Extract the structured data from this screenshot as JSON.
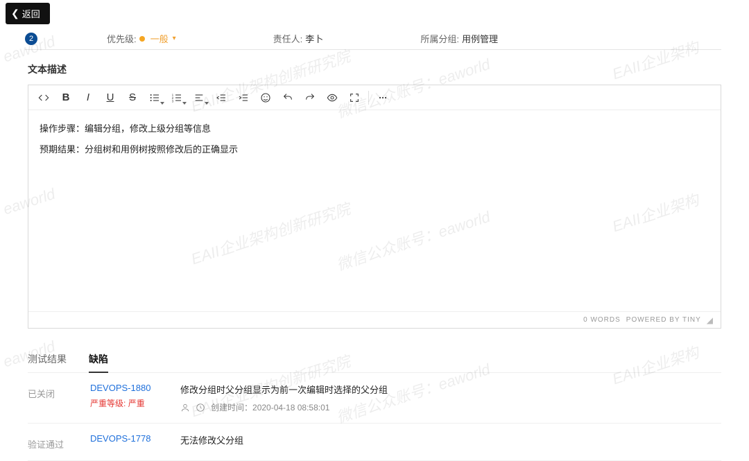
{
  "back_label": "返回",
  "meta": {
    "badge_number": "2",
    "priority_label": "优先级:",
    "priority_value": "一般",
    "owner_label": "责任人:",
    "owner_value": "李卜",
    "group_label": "所属分组:",
    "group_value": "用例管理"
  },
  "description": {
    "title": "文本描述",
    "line1": "操作步骤：编辑分组，修改上级分组等信息",
    "line2": "预期结果：分组树和用例树按照修改后的正确显示",
    "footer_words": "0 WORDS",
    "footer_powered": "POWERED BY TINY"
  },
  "tabs": {
    "results": "测试结果",
    "defects": "缺陷"
  },
  "defects": [
    {
      "status": "已关闭",
      "id": "DEVOPS-1880",
      "sev_label": "严重等级:",
      "sev_value": "严重",
      "title": "修改分组时父分组显示为前一次编辑时选择的父分组",
      "created_label": "创建时间：",
      "created_value": "2020-04-18 08:58:01"
    },
    {
      "status": "验证通过",
      "id": "DEVOPS-1778",
      "sev_label": "",
      "sev_value": "",
      "title": "无法修改父分组",
      "created_label": "",
      "created_value": ""
    }
  ],
  "watermark": {
    "a": "号：eaworld",
    "b": "EAII企业架构创新研究院",
    "c": "微信公众账号：eaworld",
    "d": "EAII企业架构"
  }
}
